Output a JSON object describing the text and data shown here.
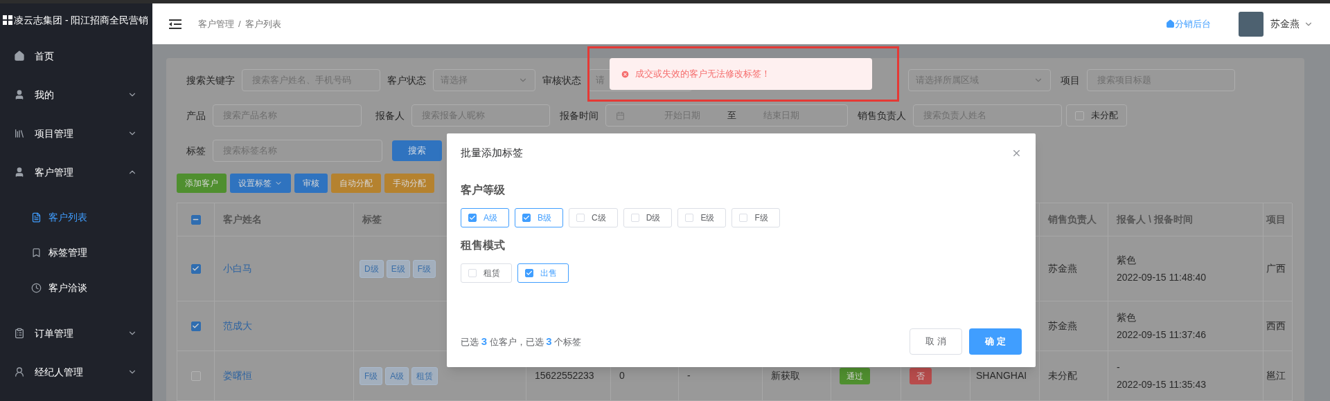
{
  "sidebar": {
    "logo": "凌云志集团 - 阳江招商全民营销",
    "menu": [
      {
        "label": "首页",
        "kind": "link"
      },
      {
        "label": "我的",
        "kind": "group",
        "expanded": false
      },
      {
        "label": "项目管理",
        "kind": "group",
        "expanded": false
      },
      {
        "label": "客户管理",
        "kind": "group",
        "expanded": true,
        "children": [
          {
            "label": "客户列表",
            "selected": true
          },
          {
            "label": "标签管理",
            "selected": false
          },
          {
            "label": "客户洽谈",
            "selected": false
          }
        ]
      },
      {
        "label": "订单管理",
        "kind": "group",
        "expanded": false
      },
      {
        "label": "经纪人管理",
        "kind": "group",
        "expanded": false
      }
    ]
  },
  "header": {
    "breadcrumb": [
      "客户管理",
      "客户列表"
    ],
    "breadcrumb_separator": "/",
    "backend_link": "分销后台",
    "user_name": "苏金燕"
  },
  "filters": [
    [
      {
        "label": "搜索关键字",
        "kind": "input",
        "placeholder": "搜索客户姓名、手机号码"
      },
      {
        "label": "客户状态",
        "kind": "select",
        "placeholder": "请选择"
      },
      {
        "label": "审核状态",
        "kind": "select",
        "placeholder": "请"
      },
      {
        "kind": "select",
        "placeholder": "请选择所属区域"
      },
      {
        "label": "项目",
        "kind": "input",
        "placeholder": "搜索项目标题"
      }
    ],
    [
      {
        "label": "产品",
        "kind": "input",
        "placeholder": "搜索产品名称"
      },
      {
        "label": "报备人",
        "kind": "input",
        "placeholder": "搜索报备人昵称"
      },
      {
        "label": "报备时间",
        "kind": "daterange",
        "start_placeholder": "开始日期",
        "separator": "至",
        "end_placeholder": "结束日期"
      },
      {
        "label": "销售负责人",
        "kind": "input",
        "placeholder": "搜索负责人姓名"
      },
      {
        "label": "未分配",
        "kind": "checkbox",
        "checked": false
      }
    ],
    [
      {
        "label": "标签",
        "kind": "input",
        "placeholder": "搜索标签名称"
      },
      {
        "label": "搜索",
        "kind": "button"
      }
    ]
  ],
  "actions": [
    {
      "label": "添加客户",
      "kind": "success",
      "dropdown": false
    },
    {
      "label": "设置标签",
      "kind": "primary",
      "dropdown": true
    },
    {
      "label": "审核",
      "kind": "primary",
      "dropdown": false
    },
    {
      "label": "自动分配",
      "kind": "warning",
      "dropdown": false
    },
    {
      "label": "手动分配",
      "kind": "warning",
      "dropdown": false
    }
  ],
  "table": {
    "header_checkbox": {
      "indeterminate": true
    },
    "columns": [
      "客户姓名",
      "标签",
      "销售负责人",
      "报备人 \\ 报备时间",
      "项目"
    ],
    "rows": [
      {
        "selected": true,
        "name": "小白马",
        "tags": [
          "D级",
          "E级",
          "F级"
        ],
        "sales": "苏金燕",
        "reporter": "紫色",
        "report_time": "2022-09-15 11:48:40",
        "project": "广西"
      },
      {
        "selected": true,
        "name": "范成大",
        "tags": [],
        "sales": "苏金燕",
        "reporter": "紫色",
        "report_time": "2022-09-15 11:37:46",
        "project": "西西"
      },
      {
        "selected": false,
        "name": "娄曙恒",
        "tags": [
          "F级",
          "A级",
          "租赁"
        ],
        "phone": "15622552233",
        "column_5": "0",
        "column_6": "-",
        "status": "新获取",
        "audit": "通过",
        "column_9": "否",
        "region": "SHANGHAI",
        "sales": "未分配",
        "reporter": "-",
        "report_time": "2022-09-15 11:35:43",
        "project": "邕江"
      }
    ]
  },
  "toast": {
    "kind": "error",
    "message": "成交或失效的客户无法修改标签！"
  },
  "dialog": {
    "title": "批量添加标签",
    "groups": [
      {
        "title": "客户等级",
        "options": [
          {
            "label": "A级",
            "checked": true
          },
          {
            "label": "B级",
            "checked": true
          },
          {
            "label": "C级",
            "checked": false
          },
          {
            "label": "D级",
            "checked": false
          },
          {
            "label": "E级",
            "checked": false
          },
          {
            "label": "F级",
            "checked": false
          }
        ]
      },
      {
        "title": "租售模式",
        "options": [
          {
            "label": "租赁",
            "checked": false
          },
          {
            "label": "出售",
            "checked": true
          }
        ]
      }
    ],
    "summary": "已选 **3** 位客户，已选 **3** 个标签",
    "buttons": [
      {
        "label": "取 消",
        "kind": "secondary"
      },
      {
        "label": "确 定",
        "kind": "primary"
      }
    ]
  }
}
